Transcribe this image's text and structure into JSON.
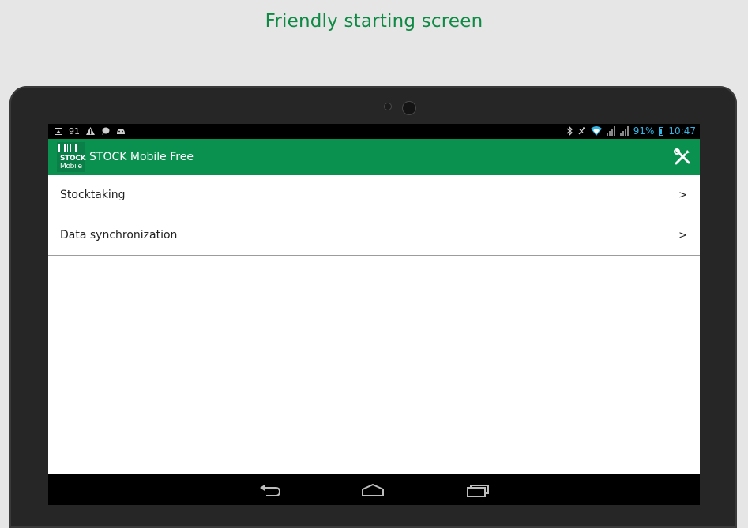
{
  "caption": "Friendly starting screen",
  "status_bar": {
    "notification_count": "91",
    "battery_percent": "91%",
    "time": "10:47",
    "left_icons": [
      "image-icon",
      "warning-icon",
      "chat-icon",
      "android-icon"
    ],
    "right_icons": [
      "bluetooth-icon",
      "mute-icon",
      "wifi-icon",
      "signal-icon",
      "battery-icon"
    ]
  },
  "app_bar": {
    "logo_top": "STOCK",
    "logo_bottom": "Mobile",
    "title": "STOCK Mobile Free",
    "action_icon": "settings-tools-icon"
  },
  "menu": {
    "items": [
      {
        "label": "Stocktaking",
        "arrow": ">"
      },
      {
        "label": "Data synchronization",
        "arrow": ">"
      }
    ]
  },
  "nav_bar": {
    "buttons": [
      "back-icon",
      "home-icon",
      "recents-icon"
    ]
  },
  "colors": {
    "brand_green": "#0a9150",
    "caption_green": "#0f8a45",
    "accent_blue": "#33b5e5"
  }
}
